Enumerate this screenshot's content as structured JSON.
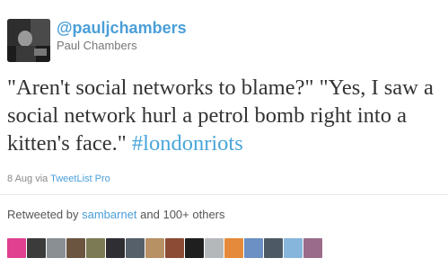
{
  "author": {
    "handle": "@pauljchambers",
    "name": "Paul Chambers"
  },
  "tweet": {
    "text": "\"Aren't social networks to blame?\" \"Yes, I saw a social network hurl a petrol bomb right into a kitten's face.\" ",
    "hashtag": "#londonriots"
  },
  "meta": {
    "date": "8 Aug",
    "via_prefix": "via",
    "client": "TweetList Pro"
  },
  "retweets": {
    "prefix": "Retweeted by",
    "user": "sambarnet",
    "suffix": "and 100+ others"
  },
  "colors": {
    "link": "#4a9fd8",
    "hashtag": "#4aa6da",
    "text": "#333333",
    "muted": "#777777"
  },
  "retweeter_avatars": [
    {
      "icon": "avatar-pink",
      "color": "#e0408f"
    },
    {
      "icon": "avatar-dark",
      "color": "#3b3b3b"
    },
    {
      "icon": "avatar-gray",
      "color": "#8a8f94"
    },
    {
      "icon": "avatar-brown",
      "color": "#6b5440"
    },
    {
      "icon": "avatar-olive",
      "color": "#7b7a55"
    },
    {
      "icon": "avatar-charcoal",
      "color": "#2f2f33"
    },
    {
      "icon": "avatar-slate",
      "color": "#55606b"
    },
    {
      "icon": "avatar-tan",
      "color": "#b79064"
    },
    {
      "icon": "avatar-rust",
      "color": "#8c4b34"
    },
    {
      "icon": "avatar-black",
      "color": "#1f1f1f"
    },
    {
      "icon": "avatar-silver",
      "color": "#b5b8bb"
    },
    {
      "icon": "avatar-orange",
      "color": "#e58a3a"
    },
    {
      "icon": "avatar-blue",
      "color": "#6c8fc4"
    },
    {
      "icon": "avatar-steel",
      "color": "#4d5a66"
    },
    {
      "icon": "avatar-sky",
      "color": "#87b6dd"
    },
    {
      "icon": "avatar-mauve",
      "color": "#9a6b8a"
    }
  ]
}
